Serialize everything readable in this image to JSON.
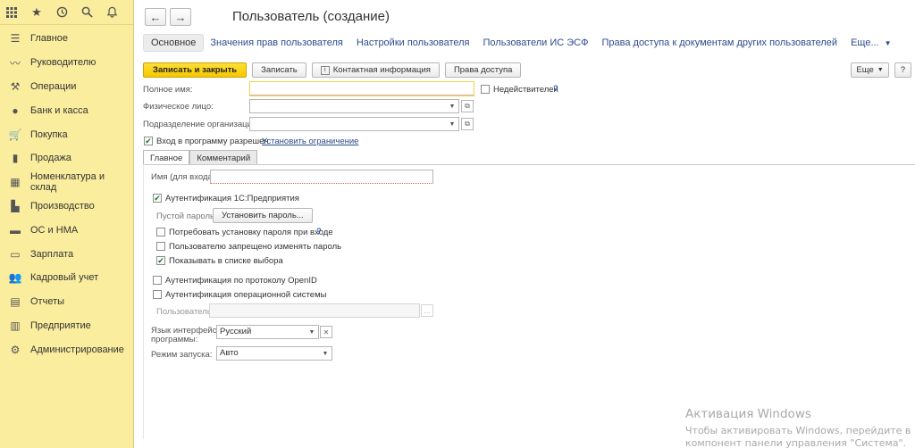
{
  "sidebar": {
    "top_icons": [
      "apps-grid-icon",
      "star-icon",
      "history-icon",
      "search-icon",
      "bell-icon"
    ],
    "items": [
      {
        "label": "Главное",
        "icon": "menu-icon"
      },
      {
        "label": "Руководителю",
        "icon": "trend-icon"
      },
      {
        "label": "Операции",
        "icon": "operations-icon"
      },
      {
        "label": "Банк и касса",
        "icon": "coin-icon"
      },
      {
        "label": "Покупка",
        "icon": "cart-icon"
      },
      {
        "label": "Продажа",
        "icon": "bag-icon"
      },
      {
        "label": "Номенклатура и склад",
        "icon": "boxes-icon"
      },
      {
        "label": "Производство",
        "icon": "factory-icon"
      },
      {
        "label": "ОС и НМА",
        "icon": "truck-icon"
      },
      {
        "label": "Зарплата",
        "icon": "wallet-icon"
      },
      {
        "label": "Кадровый учет",
        "icon": "people-icon"
      },
      {
        "label": "Отчеты",
        "icon": "report-icon"
      },
      {
        "label": "Предприятие",
        "icon": "building-icon"
      },
      {
        "label": "Администрирование",
        "icon": "gear-icon"
      }
    ]
  },
  "header": {
    "back": "←",
    "forward": "→",
    "title": "Пользователь (создание)"
  },
  "nav_tabs": {
    "main": "Основное",
    "links": [
      "Значения прав пользователя",
      "Настройки пользователя",
      "Пользователи ИС ЭСФ",
      "Права доступа к документам других пользователей"
    ],
    "more": "Еще..."
  },
  "toolbar": {
    "save_close": "Записать и закрыть",
    "save": "Записать",
    "contact_info": "Контактная информация",
    "access_rights": "Права доступа",
    "more": "Еще",
    "help": "?"
  },
  "form": {
    "full_name_label": "Полное имя:",
    "full_name_value": "",
    "invalid_label": "Недействителен",
    "invalid_checked": false,
    "individual_label": "Физическое лицо:",
    "individual_value": "",
    "department_label": "Подразделение организации:",
    "department_value": "",
    "login_allowed_label": "Вход в программу разрешен",
    "login_allowed_checked": true,
    "set_restriction_link": "Установить ограничение"
  },
  "inner_tabs": [
    "Главное",
    "Комментарий"
  ],
  "main_tab": {
    "login_name_label": "Имя (для входа):",
    "login_name_value": "",
    "auth_1c_label": "Аутентификация 1С:Предприятия",
    "auth_1c_checked": true,
    "empty_password_label": "Пустой пароль",
    "set_password_button": "Установить пароль...",
    "require_password_label": "Потребовать установку пароля при входе",
    "require_password_checked": false,
    "forbid_change_label": "Пользователю запрещено изменять пароль",
    "forbid_change_checked": false,
    "show_in_list_label": "Показывать в списке выбора",
    "show_in_list_checked": true,
    "openid_label": "Аутентификация по протоколу OpenID",
    "openid_checked": false,
    "os_auth_label": "Аутентификация операционной системы",
    "os_auth_checked": false,
    "os_user_label": "Пользователь:",
    "os_user_value": "",
    "language_label_1": "Язык интерфейса",
    "language_label_2": "программы:",
    "language_value": "Русский",
    "launch_mode_label": "Режим запуска:",
    "launch_mode_value": "Авто"
  },
  "watermark": {
    "line1": "Активация Windows",
    "line2": "Чтобы активировать Windows, перейдите в",
    "line3": "компонент панели управления \"Система\"."
  },
  "colors": {
    "sidebar_bg": "#fbed9e",
    "primary_button": "#f5c700",
    "link": "#2d4b8e",
    "checkbox_check": "#1b7a2e"
  }
}
